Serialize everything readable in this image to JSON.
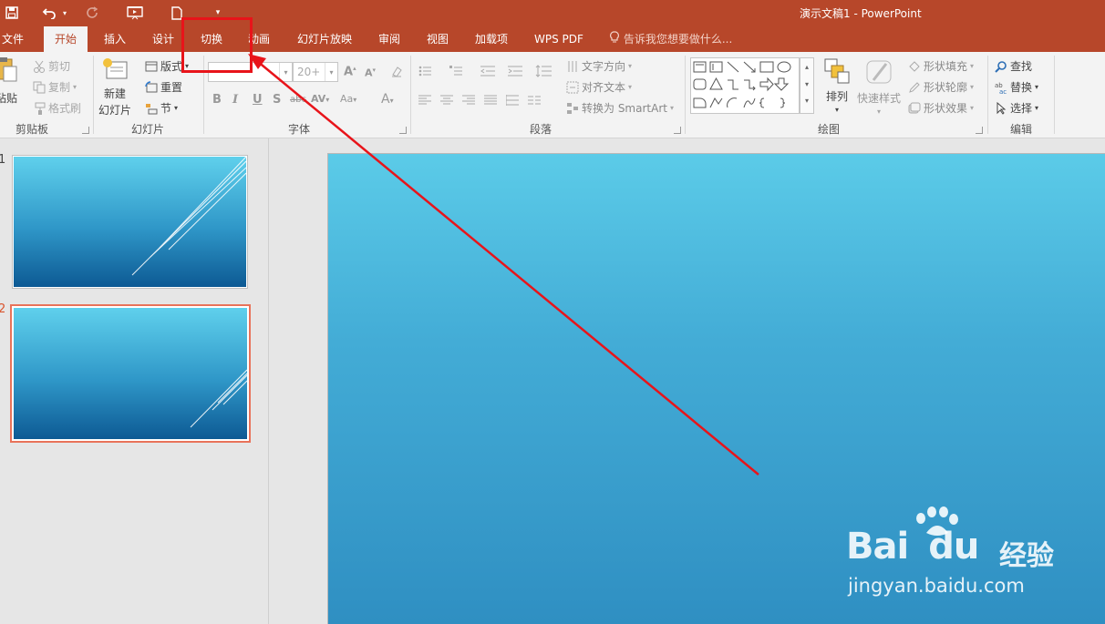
{
  "window": {
    "title": "演示文稿1 - PowerPoint"
  },
  "qat": {
    "more_label": "▾"
  },
  "tabs": {
    "file": "文件",
    "home": "开始",
    "insert": "插入",
    "design": "设计",
    "transitions": "切换",
    "animations": "动画",
    "slideshow": "幻灯片放映",
    "review": "审阅",
    "view": "视图",
    "addins": "加载项",
    "wpspdf": "WPS PDF",
    "tellme": "告诉我您想要做什么..."
  },
  "ribbon": {
    "clipboard": {
      "paste": "粘贴",
      "cut": "剪切",
      "copy": "复制",
      "format_painter": "格式刷",
      "group": "剪贴板"
    },
    "slides": {
      "new_slide_line1": "新建",
      "new_slide_line2": "幻灯片",
      "layout": "版式",
      "reset": "重置",
      "section": "节",
      "group": "幻灯片"
    },
    "font": {
      "font_name": "",
      "font_size": "20+",
      "grow": "A",
      "shrink": "A",
      "bold": "B",
      "italic": "I",
      "underline": "U",
      "shadow": "S",
      "strike": "abc",
      "spacing": "AV",
      "case": "Aa",
      "color": "A",
      "group": "字体"
    },
    "paragraph": {
      "text_direction": "文字方向",
      "align_text": "对齐文本",
      "smartart": "转换为 SmartArt",
      "group": "段落"
    },
    "drawing": {
      "arrange": "排列",
      "quick_styles": "快速样式",
      "shape_fill": "形状填充",
      "shape_outline": "形状轮廓",
      "shape_effects": "形状效果",
      "group": "绘图"
    },
    "editing": {
      "find": "查找",
      "replace": "替换",
      "select": "选择",
      "group": "编辑"
    }
  },
  "slides_panel": {
    "slides": [
      {
        "number": "1",
        "selected": false
      },
      {
        "number": "2",
        "selected": true
      }
    ]
  },
  "watermark": {
    "brand": "Bai",
    "brand2": "du",
    "product": "经验",
    "url": "jingyan.baidu.com"
  },
  "colors": {
    "accent": "#b7472a",
    "annotation": "#e8141a",
    "slide_top": "#5bcbe8",
    "slide_bottom": "#2f8fc2",
    "selection": "#e8735a"
  }
}
